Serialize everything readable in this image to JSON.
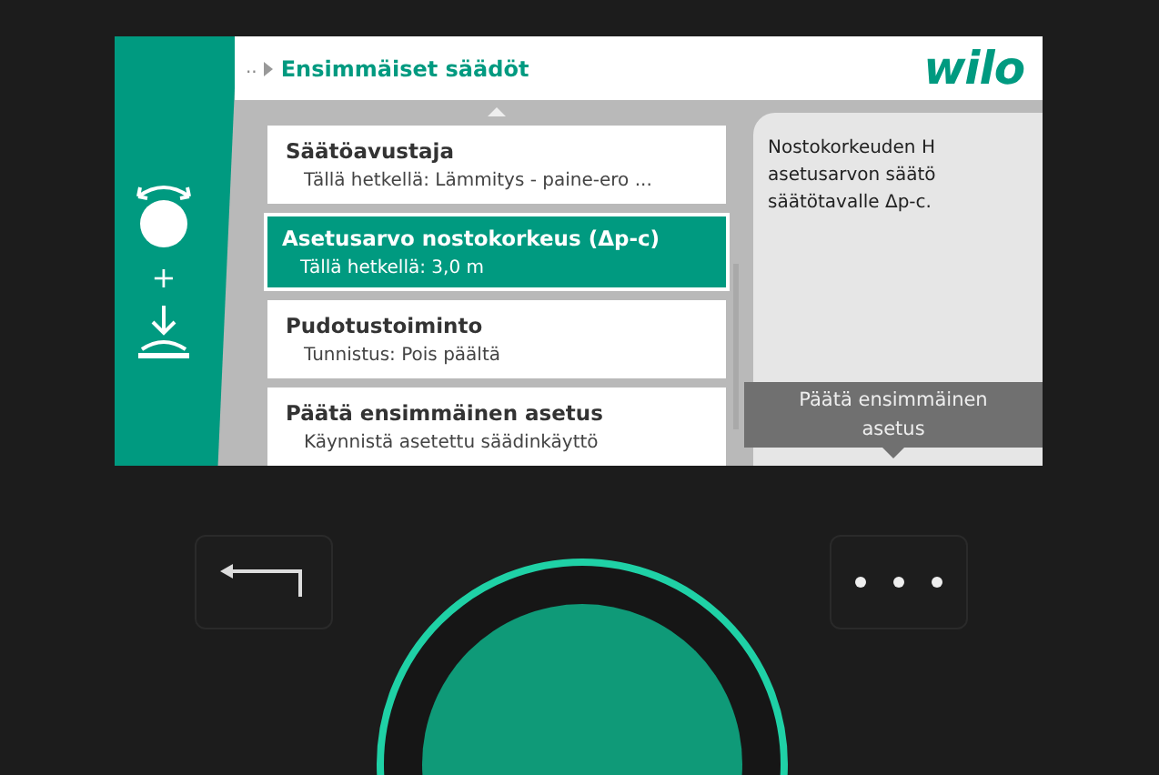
{
  "header": {
    "breadcrumb": "..",
    "title": "Ensimmäiset säädöt",
    "logo": "wilo"
  },
  "sidebar": {
    "plus": "+"
  },
  "menu": [
    {
      "title": "Säätöavustaja",
      "subtitle": "Tällä hetkellä: Lämmitys - paine-ero ...",
      "selected": false
    },
    {
      "title": "Asetusarvo nostokorkeus (Δp-c)",
      "subtitle": "Tällä hetkellä: 3,0 m",
      "selected": true
    },
    {
      "title": "Pudotustoiminto",
      "subtitle": "Tunnistus: Pois päältä",
      "selected": false
    },
    {
      "title": "Päätä ensimmäinen asetus",
      "subtitle": "Käynnistä asetettu säädinkäyttö",
      "selected": false
    }
  ],
  "help_text": "Nostokorkeuden H asetusarvon säätö säätötavalle Δp-c.",
  "action_hint": "Päätä ensimmäinen asetus"
}
